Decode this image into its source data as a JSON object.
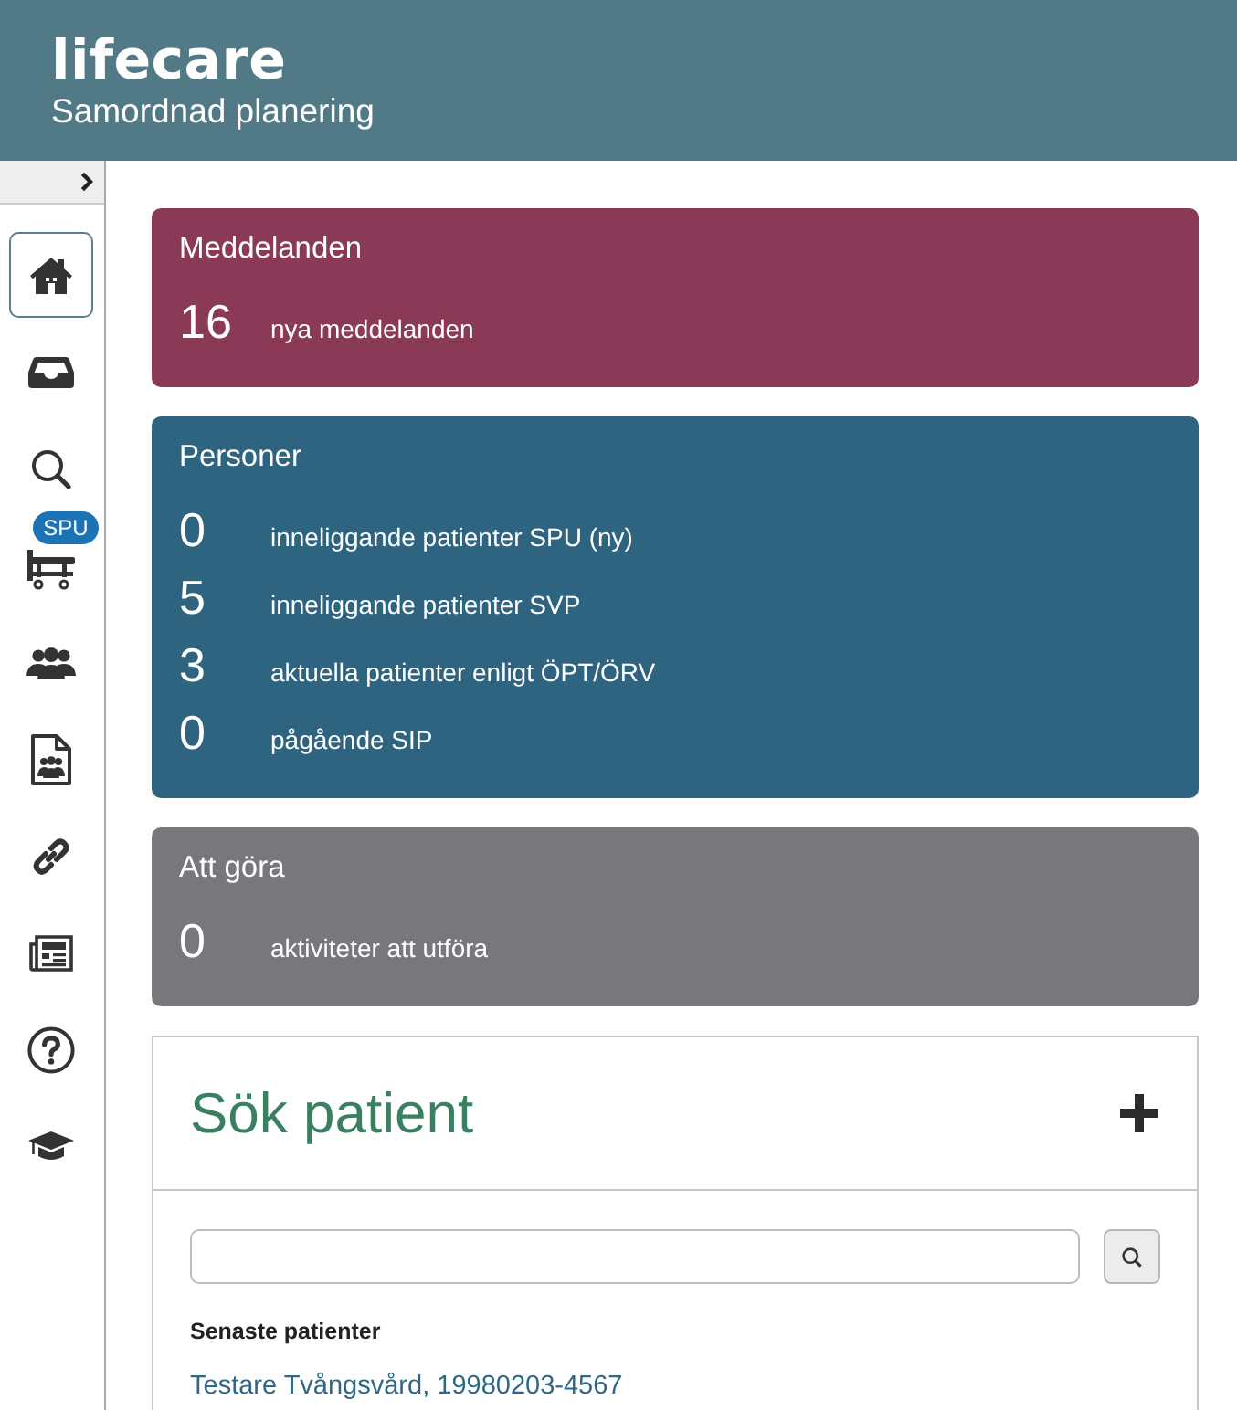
{
  "header": {
    "logo": "lifecare",
    "subtitle": "Samordnad planering"
  },
  "sidebar": {
    "collapsed": true,
    "items": [
      {
        "kind": "home",
        "selected": true
      },
      {
        "kind": "inbox",
        "selected": false
      },
      {
        "kind": "search",
        "selected": false
      },
      {
        "kind": "bed",
        "selected": false,
        "badge": "SPU"
      },
      {
        "kind": "people",
        "selected": false
      },
      {
        "kind": "document",
        "selected": false
      },
      {
        "kind": "link",
        "selected": false
      },
      {
        "kind": "news",
        "selected": false
      },
      {
        "kind": "help",
        "selected": false
      },
      {
        "kind": "education",
        "selected": false
      }
    ]
  },
  "cards": [
    {
      "title": "Meddelanden",
      "color": "#8a3a57",
      "rows": [
        {
          "count": "16",
          "label": "nya meddelanden"
        }
      ]
    },
    {
      "title": "Personer",
      "color": "#2e6480",
      "rows": [
        {
          "count": "0",
          "label": "inneliggande patienter SPU (ny)"
        },
        {
          "count": "5",
          "label": "inneliggande patienter SVP"
        },
        {
          "count": "3",
          "label": "aktuella patienter enligt ÖPT/ÖRV"
        },
        {
          "count": "0",
          "label": "pågående SIP"
        }
      ]
    },
    {
      "title": "Att göra",
      "color": "#78777c",
      "rows": [
        {
          "count": "0",
          "label": "aktiviteter att utföra"
        }
      ]
    }
  ],
  "patient_search": {
    "title": "Sök patient",
    "recent_heading": "Senaste patienter",
    "recent": [
      "Testare Tvångsvård, 19980203-4567"
    ]
  }
}
